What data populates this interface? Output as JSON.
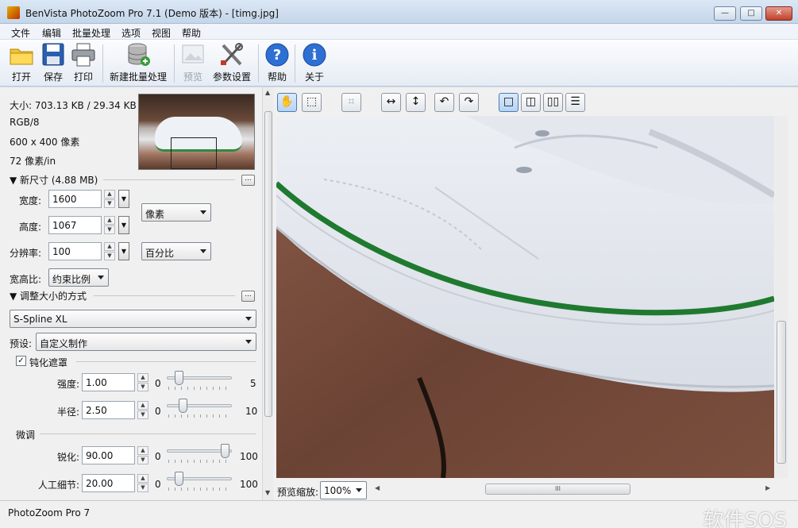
{
  "window": {
    "title": "BenVista PhotoZoom Pro 7.1 (Demo 版本) - [timg.jpg]",
    "buttons": {
      "minimize": "—",
      "maximize": "□",
      "close": "✕"
    }
  },
  "menu": [
    "文件",
    "编辑",
    "批量处理",
    "选项",
    "视图",
    "帮助"
  ],
  "toolbar": {
    "open": "打开",
    "save": "保存",
    "print": "打印",
    "new_batch": "新建批量处理",
    "preview": "预览",
    "params": "参数设置",
    "help": "帮助",
    "about": "关于"
  },
  "info": {
    "size": "大小: 703.13 KB / 29.34 KB",
    "mode": "RGB/8",
    "dimensions": "600 x 400 像素",
    "resolution": "72 像素/in"
  },
  "new_size": {
    "header": "▼ 新尺寸 (4.88 MB)",
    "more": "...",
    "width_label": "宽度:",
    "width_value": "1600",
    "height_label": "高度:",
    "height_value": "1067",
    "resolution_label": "分辨率:",
    "resolution_value": "100",
    "unit_select": "像素",
    "res_unit_select": "百分比",
    "aspect_label": "宽高比:",
    "aspect_select": "约束比例"
  },
  "resize_method": {
    "header": "▼ 调整大小的方式",
    "more": "...",
    "method_select": "S-Spline XL",
    "preset_label": "预设:",
    "preset_select": "自定义制作"
  },
  "unsharp": {
    "checkbox_mark": "✓",
    "label": "钝化遮罩",
    "strength_label": "强度:",
    "strength_value": "1.00",
    "strength_min": "0",
    "strength_max": "5",
    "strength_level": 0.2,
    "radius_label": "半径:",
    "radius_value": "2.50",
    "radius_min": "0",
    "radius_max": "10",
    "radius_level": 0.25
  },
  "finetune": {
    "header": "微调",
    "sharpen_label": "锐化:",
    "sharpen_value": "90.00",
    "sharpen_min": "0",
    "sharpen_max": "100",
    "sharpen_level": 0.9,
    "detail_label": "人工细节:",
    "detail_value": "20.00",
    "detail_min": "0",
    "detail_max": "100",
    "detail_level": 0.2
  },
  "preview": {
    "zoom_label": "预览缩放:",
    "zoom_value": "100%",
    "hscroll_grip": "III"
  },
  "status": {
    "text": "PhotoZoom Pro 7",
    "watermark": "软件SOS"
  }
}
